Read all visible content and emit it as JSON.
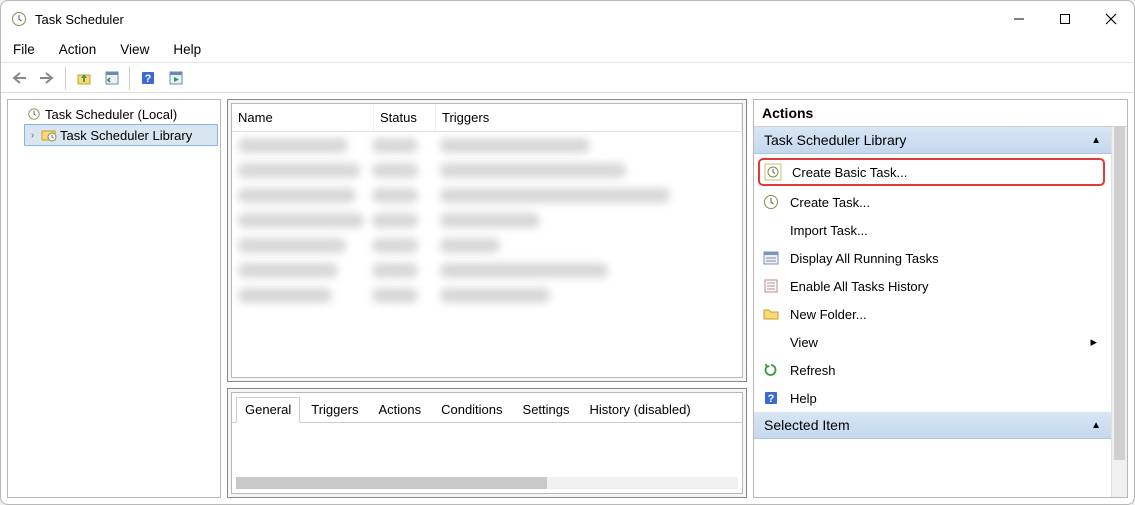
{
  "window": {
    "title": "Task Scheduler"
  },
  "menu": {
    "file": "File",
    "action": "Action",
    "view": "View",
    "help": "Help"
  },
  "tree": {
    "root": "Task Scheduler (Local)",
    "library": "Task Scheduler Library"
  },
  "list": {
    "col_name": "Name",
    "col_status": "Status",
    "col_triggers": "Triggers"
  },
  "tabs": {
    "general": "General",
    "triggers": "Triggers",
    "actions": "Actions",
    "conditions": "Conditions",
    "settings": "Settings",
    "history": "History (disabled)"
  },
  "actions": {
    "title": "Actions",
    "group_library": "Task Scheduler Library",
    "create_basic": "Create Basic Task...",
    "create_task": "Create Task...",
    "import_task": "Import Task...",
    "display_running": "Display All Running Tasks",
    "enable_history": "Enable All Tasks History",
    "new_folder": "New Folder...",
    "view": "View",
    "refresh": "Refresh",
    "help": "Help",
    "group_selected": "Selected Item"
  }
}
